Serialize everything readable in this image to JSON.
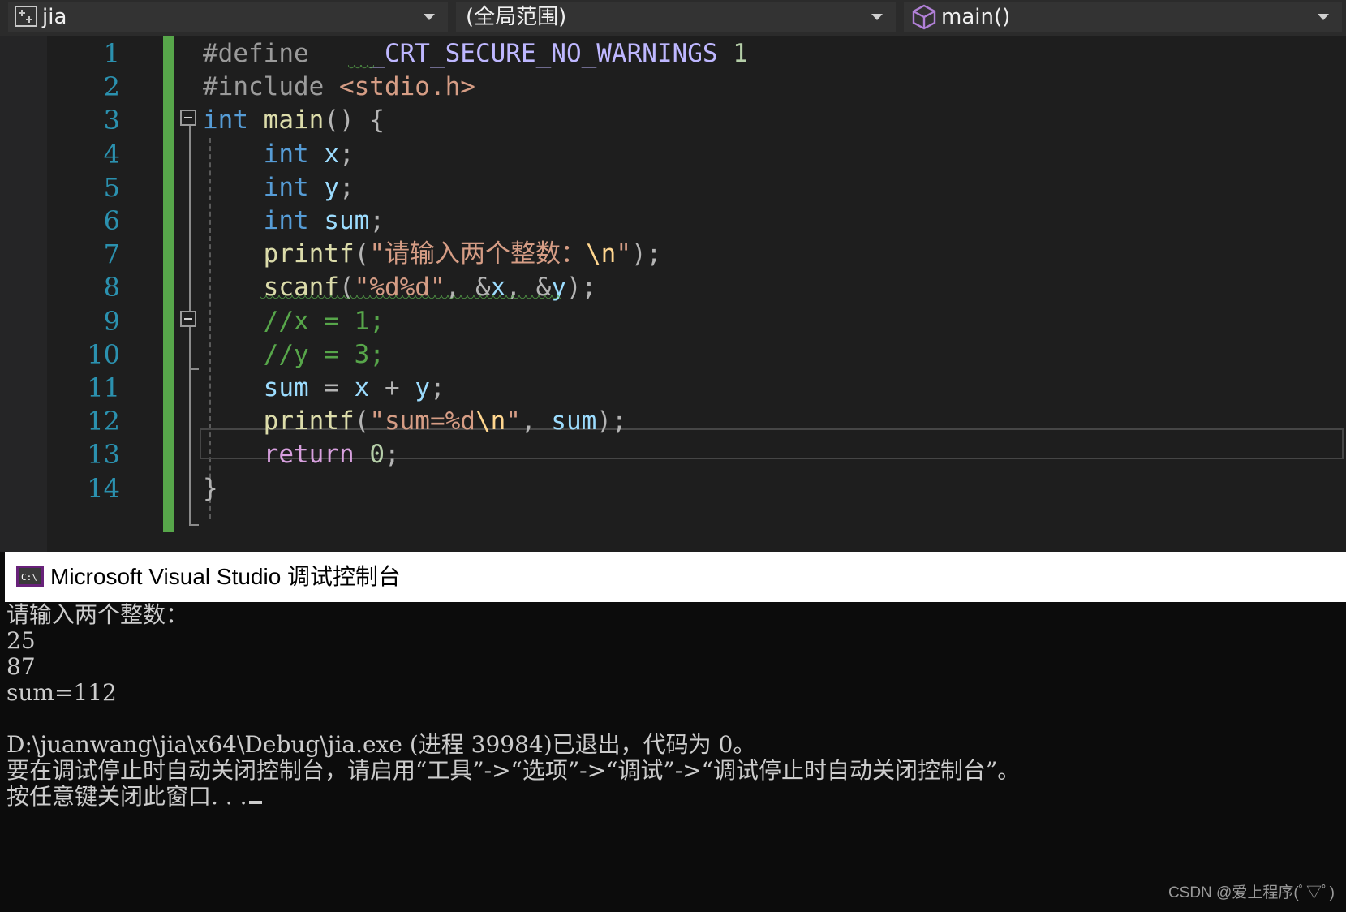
{
  "navbar": {
    "project": "jia",
    "scope": "(全局范围)",
    "function": "main()"
  },
  "editor": {
    "line_numbers": [
      "1",
      "2",
      "3",
      "4",
      "5",
      "6",
      "7",
      "8",
      "9",
      "10",
      "11",
      "12",
      "13",
      "14"
    ],
    "lines": [
      [
        [
          "pp",
          "#define"
        ],
        [
          "pln",
          "    "
        ],
        [
          "macro",
          "_CRT_SECURE_NO_WARNINGS"
        ],
        [
          "pln",
          " "
        ],
        [
          "num",
          "1"
        ]
      ],
      [
        [
          "pp",
          "#include "
        ],
        [
          "str",
          "<stdio.h>"
        ]
      ],
      [
        [
          "kw",
          "int"
        ],
        [
          "pln",
          " "
        ],
        [
          "fn",
          "main"
        ],
        [
          "pun",
          "() {"
        ]
      ],
      [
        [
          "pln",
          "    "
        ],
        [
          "kw",
          "int"
        ],
        [
          "pln",
          " "
        ],
        [
          "var",
          "x"
        ],
        [
          "pun",
          ";"
        ]
      ],
      [
        [
          "pln",
          "    "
        ],
        [
          "kw",
          "int"
        ],
        [
          "pln",
          " "
        ],
        [
          "var",
          "y"
        ],
        [
          "pun",
          ";"
        ]
      ],
      [
        [
          "pln",
          "    "
        ],
        [
          "kw",
          "int"
        ],
        [
          "pln",
          " "
        ],
        [
          "var",
          "sum"
        ],
        [
          "pun",
          ";"
        ]
      ],
      [
        [
          "pln",
          "    "
        ],
        [
          "fn",
          "printf"
        ],
        [
          "pun",
          "("
        ],
        [
          "str",
          "\"请输入两个整数："
        ],
        [
          "esc",
          "\\n"
        ],
        [
          "str",
          "\""
        ],
        [
          "pun",
          ");"
        ]
      ],
      [
        [
          "pln",
          "    "
        ],
        [
          "fn",
          "scanf"
        ],
        [
          "pun",
          "("
        ],
        [
          "str",
          "\"%d%d\""
        ],
        [
          "pun",
          ", &"
        ],
        [
          "var",
          "x"
        ],
        [
          "pun",
          ", &"
        ],
        [
          "var",
          "y"
        ],
        [
          "pun",
          ");"
        ]
      ],
      [
        [
          "pln",
          "    "
        ],
        [
          "cm",
          "//x = 1;"
        ]
      ],
      [
        [
          "pln",
          "    "
        ],
        [
          "cm",
          "//y = 3;"
        ]
      ],
      [
        [
          "pln",
          "    "
        ],
        [
          "var",
          "sum"
        ],
        [
          "pun",
          " = "
        ],
        [
          "var",
          "x"
        ],
        [
          "pun",
          " + "
        ],
        [
          "var",
          "y"
        ],
        [
          "pun",
          ";"
        ]
      ],
      [
        [
          "pln",
          "    "
        ],
        [
          "fn",
          "printf"
        ],
        [
          "pun",
          "("
        ],
        [
          "str",
          "\"sum=%d"
        ],
        [
          "esc",
          "\\n"
        ],
        [
          "str",
          "\""
        ],
        [
          "pun",
          ", "
        ],
        [
          "var",
          "sum"
        ],
        [
          "pun",
          ");"
        ]
      ],
      [
        [
          "pln",
          "    "
        ],
        [
          "ctl",
          "return"
        ],
        [
          "pln",
          " "
        ],
        [
          "num",
          "0"
        ],
        [
          "pun",
          ";"
        ]
      ],
      [
        [
          "pun",
          "}"
        ]
      ]
    ]
  },
  "console": {
    "title": "Microsoft Visual Studio 调试控制台",
    "lines": [
      "请输入两个整数：",
      "25",
      "87",
      "sum=112",
      "",
      "D:\\juanwang\\jia\\x64\\Debug\\jia.exe (进程 39984)已退出，代码为 0。",
      "要在调试停止时自动关闭控制台，请启用“工具”->“选项”->“调试”->“调试停止时自动关闭控制台”。",
      "按任意键关闭此窗口. . ."
    ]
  },
  "watermark": "CSDN @爱上程序(ﾟ▽ﾟ)",
  "colors": {
    "keyword": "#569cd6",
    "function": "#dcdcaa",
    "string": "#d69d85",
    "comment": "#57a64a",
    "variable": "#9cdcfe",
    "control": "#d8a0df",
    "line_number": "#2b91af"
  },
  "icons": {
    "project": "cpp-project-icon",
    "function": "method-cube-icon",
    "console": "console-app-icon"
  }
}
